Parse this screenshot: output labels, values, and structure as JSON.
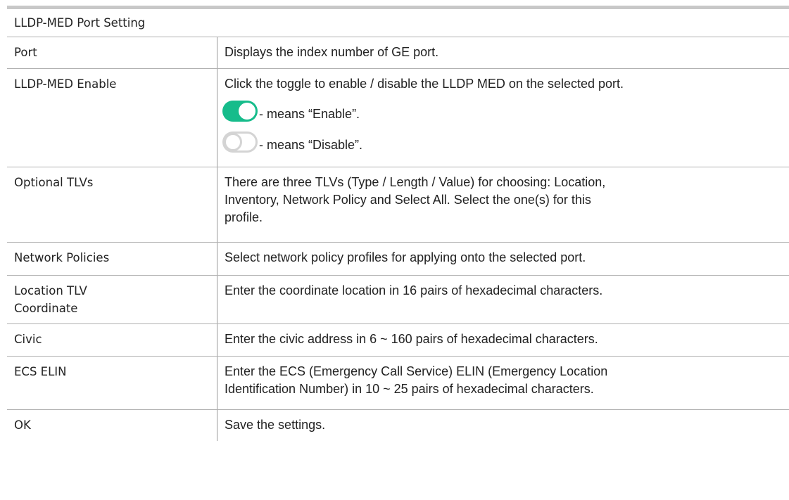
{
  "table": {
    "title": "LLDP-MED Port Setting",
    "rows": [
      {
        "term": "Port",
        "desc": "Displays the index number of GE port."
      },
      {
        "term": "LLDP-MED Enable",
        "desc": "Click the toggle to enable / disable the LLDP MED on the selected port.",
        "toggle_on_text": "- means “Enable”.",
        "toggle_off_text": "- means “Disable”."
      },
      {
        "term": "Optional TLVs",
        "desc_lines": [
          "There are three TLVs (Type / Length / Value) for choosing: Location,",
          "Inventory, Network Policy and Select All. Select the one(s) for this",
          "profile."
        ]
      },
      {
        "term": "Network Policies",
        "desc": "Select network policy profiles for applying onto the selected port."
      },
      {
        "term_lines": [
          "Location TLV",
          "Coordinate"
        ],
        "desc": "Enter the coordinate location in 16 pairs of hexadecimal characters."
      },
      {
        "term": "Civic",
        "desc": "Enter the civic address in 6 ~ 160 pairs of hexadecimal characters."
      },
      {
        "term": "ECS ELIN",
        "desc_lines": [
          "Enter the ECS (Emergency Call Service) ELIN (Emergency Location",
          "Identification Number) in 10 ~ 25 pairs of hexadecimal characters."
        ]
      },
      {
        "term": "OK",
        "desc": "Save the settings."
      }
    ]
  },
  "colors": {
    "toggle_on": "#16bc8b",
    "toggle_off_border": "#d4d4d4",
    "grid": "#b0b0b0"
  },
  "icons": {
    "enabled_toggle": "toggle-on-icon",
    "disabled_toggle": "toggle-off-icon"
  }
}
